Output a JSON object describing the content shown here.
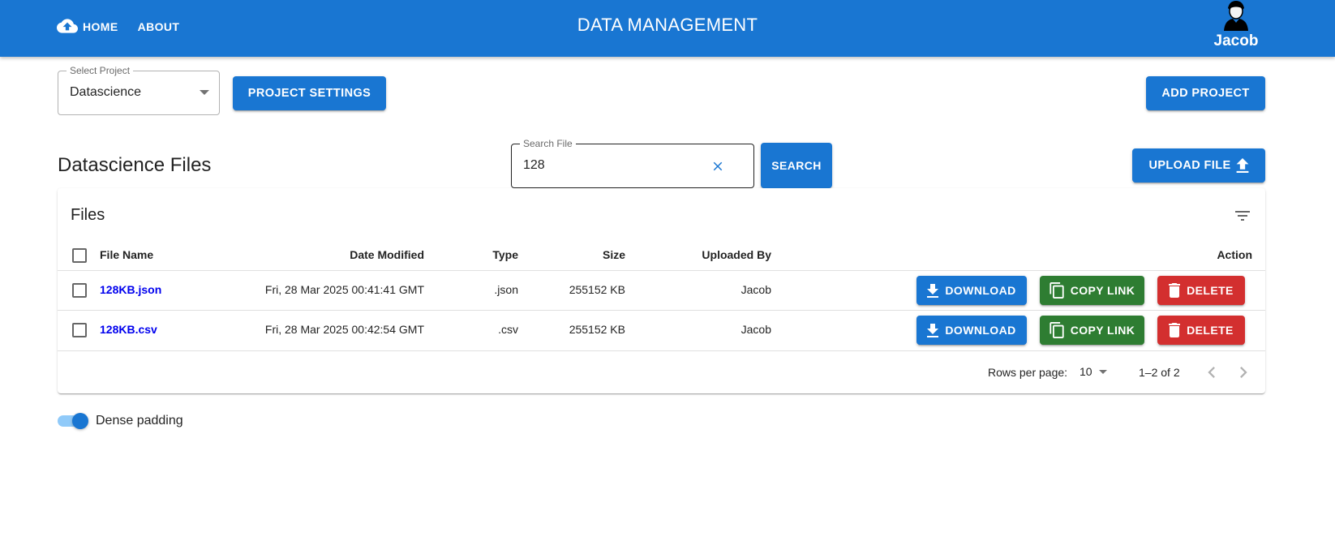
{
  "appbar": {
    "nav": [
      {
        "label": "HOME",
        "icon": "cloud-upload-icon"
      },
      {
        "label": "ABOUT"
      }
    ],
    "title": "DATA MANAGEMENT",
    "user": {
      "name": "Jacob",
      "icon": "user-avatar-icon"
    },
    "color": "#1976d2"
  },
  "project": {
    "select_label": "Select Project",
    "selected": "Datascience",
    "settings_button": "PROJECT SETTINGS",
    "add_button": "ADD PROJECT"
  },
  "files_section": {
    "title": "Datascience Files",
    "search_label": "Search File",
    "search_value": "128",
    "search_button": "SEARCH",
    "upload_button": "UPLOAD FILE"
  },
  "table": {
    "title": "Files",
    "headers": {
      "name": "File Name",
      "date": "Date Modified",
      "type": "Type",
      "size": "Size",
      "uploaded_by": "Uploaded By",
      "action": "Action"
    },
    "rows": [
      {
        "name": "128KB.json",
        "date": "Fri, 28 Mar 2025 00:41:41 GMT",
        "type": ".json",
        "size": "255152 KB",
        "uploaded_by": "Jacob"
      },
      {
        "name": "128KB.csv",
        "date": "Fri, 28 Mar 2025 00:42:54 GMT",
        "type": ".csv",
        "size": "255152 KB",
        "uploaded_by": "Jacob"
      }
    ],
    "actions": {
      "download": "DOWNLOAD",
      "copy": "COPY LINK",
      "delete": "DELETE"
    },
    "colors": {
      "download": "#1976d2",
      "copy": "#2e7d32",
      "delete": "#d32f2f"
    },
    "pagination": {
      "rows_label": "Rows per page:",
      "rows_value": "10",
      "range": "1–2 of 2"
    }
  },
  "dense": {
    "label": "Dense padding",
    "checked": true
  }
}
